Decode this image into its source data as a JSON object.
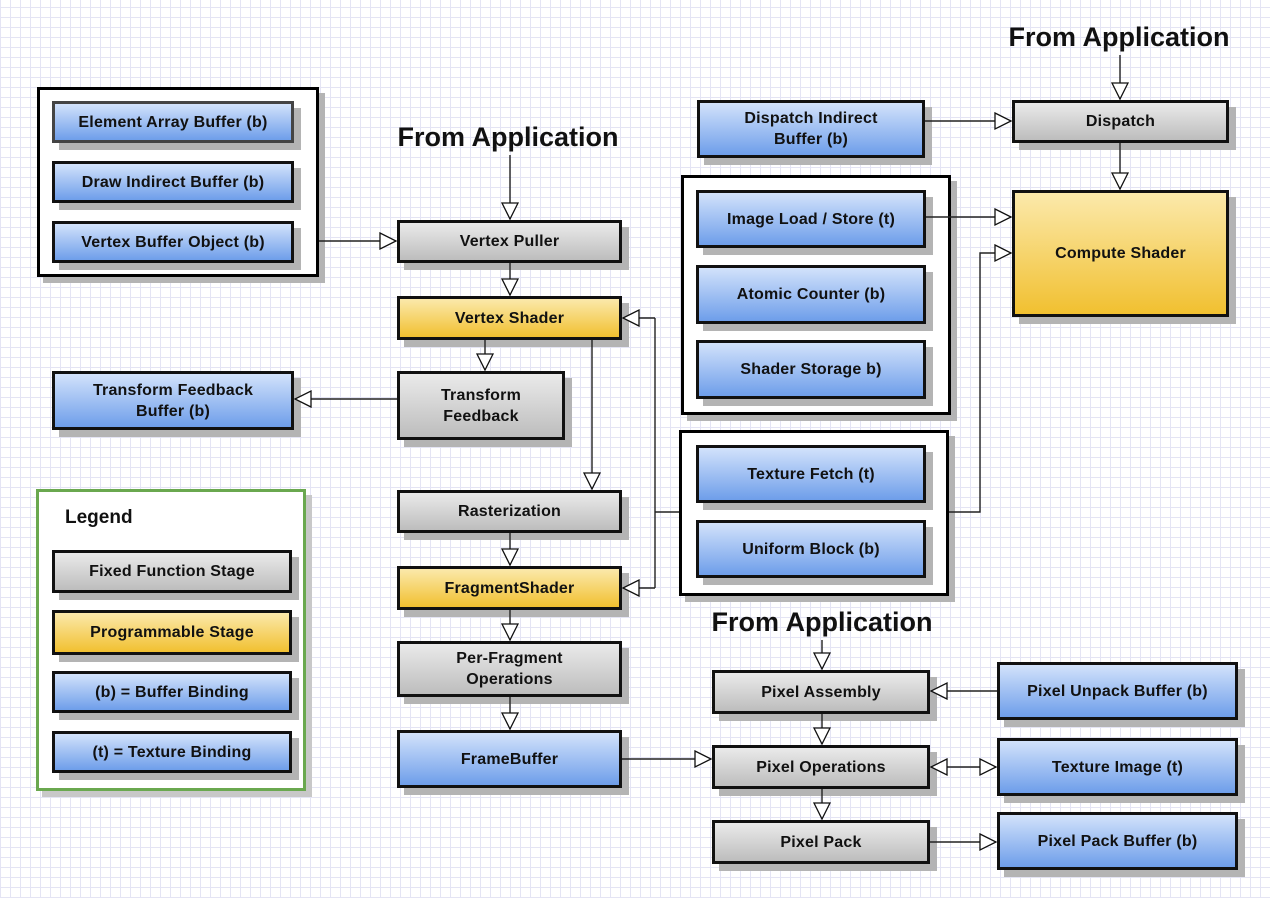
{
  "titles": {
    "from_app_vertex": "From Application",
    "from_app_compute": "From Application",
    "from_app_pixel": "From Application"
  },
  "vertex_inputs": [
    "Element Array Buffer (b)",
    "Draw Indirect Buffer (b)",
    "Vertex Buffer Object (b)"
  ],
  "pipeline": {
    "vertex_puller": "Vertex Puller",
    "vertex_shader": "Vertex Shader",
    "transform_feedback": "Transform Feedback",
    "transform_feedback_buffer": "Transform Feedback Buffer (b)",
    "rasterization": "Rasterization",
    "fragment_shader": "FragmentShader",
    "per_fragment": "Per-Fragment Operations",
    "framebuffer": "FrameBuffer"
  },
  "compute": {
    "dispatch_indirect": "Dispatch Indirect Buffer (b)",
    "dispatch": "Dispatch",
    "compute_shader": "Compute Shader"
  },
  "shader_resources": [
    "Image Load / Store (t)",
    "Atomic Counter (b)",
    "Shader Storage b)"
  ],
  "shader_inputs": [
    "Texture Fetch (t)",
    "Uniform Block (b)"
  ],
  "pixel": {
    "assembly": "Pixel Assembly",
    "unpack_buffer": "Pixel Unpack Buffer (b)",
    "operations": "Pixel Operations",
    "texture_image": "Texture Image (t)",
    "pack": "Pixel Pack",
    "pack_buffer": "Pixel Pack Buffer (b)"
  },
  "legend": {
    "title": "Legend",
    "items": [
      "Fixed Function Stage",
      "Programmable Stage",
      "(b) = Buffer Binding",
      "(t) = Texture Binding"
    ]
  },
  "colors": {
    "fixed": "#c8c8c8",
    "programmable": "#f3c63c",
    "buffer": "#7ea8ec",
    "legend_border": "#6aa84f"
  }
}
